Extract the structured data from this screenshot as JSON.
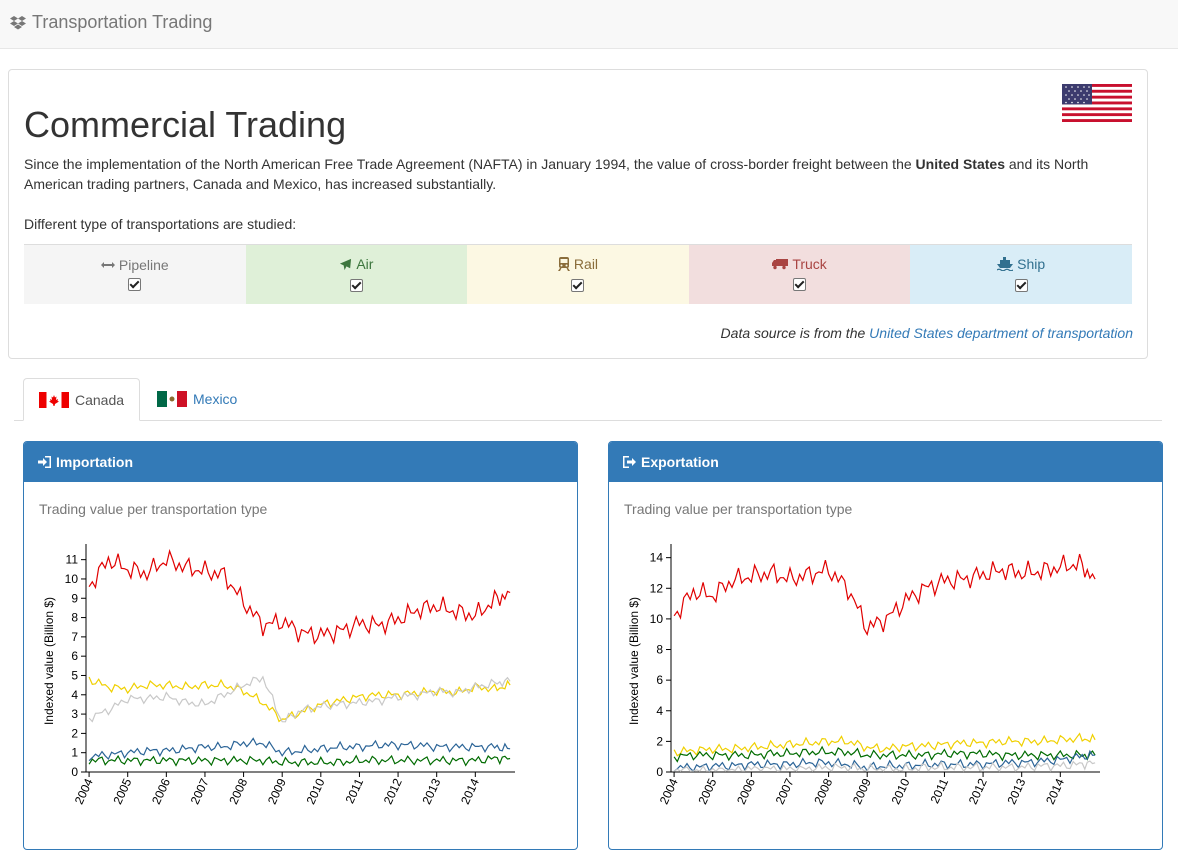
{
  "app": {
    "brand": "Transportation Trading"
  },
  "header": {
    "title": "Commercial Trading",
    "intro_before": "Since the implementation of the North American Free Trade Agreement (NAFTA) in January 1994, the value of cross-border freight between the ",
    "intro_bold": "United States",
    "intro_after": " and its North American trading partners, Canada and Mexico, has increased substantially.",
    "studied": "Different type of transportations are studied:",
    "source_prefix": "Data source is from the ",
    "source_link": "United States department of transportation"
  },
  "transports": [
    {
      "label": "Pipeline",
      "icon": "arrows-h-icon",
      "checked": true
    },
    {
      "label": "Air",
      "icon": "plane-icon",
      "checked": true
    },
    {
      "label": "Rail",
      "icon": "train-icon",
      "checked": true
    },
    {
      "label": "Truck",
      "icon": "truck-icon",
      "checked": true
    },
    {
      "label": "Ship",
      "icon": "ship-icon",
      "checked": true
    }
  ],
  "tabs": [
    {
      "label": "Canada",
      "active": true
    },
    {
      "label": "Mexico",
      "active": false
    }
  ],
  "panels": {
    "import": {
      "title": "Importation",
      "subtitle": "Trading value per transportation type"
    },
    "export": {
      "title": "Exportation",
      "subtitle": "Trading value per transportation type"
    }
  },
  "colors": {
    "truck": "#e00000",
    "rail": "#f0d000",
    "pipeline": "#c8c8c8",
    "ship": "#2b6497",
    "air": "#006b00",
    "primary": "#337ab7"
  },
  "chart_data": [
    {
      "type": "line",
      "title": "Importation",
      "ylabel": "Indexed value (Billion $)",
      "xlabel": "",
      "ylim": [
        0,
        11.5
      ],
      "yticks": [
        "0",
        "1",
        "2",
        "3",
        "4",
        "5",
        "6",
        "7",
        "8",
        "9",
        "10",
        "11"
      ],
      "xticks": [
        "2004",
        "2005",
        "2006",
        "2007",
        "2008",
        "2009",
        "2010",
        "2011",
        "2012",
        "2013",
        "2014"
      ],
      "x": [
        2004.0,
        2004.5,
        2005.0,
        2005.5,
        2006.0,
        2006.5,
        2007.0,
        2007.5,
        2008.0,
        2008.5,
        2009.0,
        2009.5,
        2010.0,
        2010.5,
        2011.0,
        2011.5,
        2012.0,
        2012.5,
        2013.0,
        2013.5,
        2014.0,
        2014.5,
        2014.9
      ],
      "series": [
        {
          "name": "Truck",
          "color": "#e00000",
          "values": [
            9.6,
            11.0,
            10.5,
            10.3,
            11.0,
            10.6,
            10.4,
            10.2,
            8.8,
            7.6,
            7.8,
            7.2,
            7.1,
            7.3,
            7.7,
            7.6,
            7.9,
            8.4,
            8.6,
            8.3,
            8.1,
            8.9,
            9.3
          ]
        },
        {
          "name": "Rail",
          "color": "#f0d000",
          "values": [
            4.8,
            4.4,
            4.3,
            4.5,
            4.5,
            4.4,
            4.5,
            4.5,
            4.2,
            3.6,
            2.7,
            3.1,
            3.5,
            3.7,
            3.9,
            4.0,
            4.0,
            4.1,
            4.2,
            4.1,
            4.4,
            4.3,
            4.5
          ]
        },
        {
          "name": "Pipeline",
          "color": "#c8c8c8",
          "values": [
            2.8,
            3.2,
            3.8,
            3.8,
            3.9,
            3.6,
            3.5,
            4.0,
            4.5,
            4.9,
            2.6,
            3.2,
            3.4,
            3.5,
            3.6,
            3.7,
            3.9,
            4.0,
            4.2,
            4.1,
            4.4,
            4.6,
            4.7
          ]
        },
        {
          "name": "Ship",
          "color": "#2b6497",
          "values": [
            0.8,
            0.9,
            1.0,
            1.1,
            1.1,
            1.2,
            1.3,
            1.3,
            1.5,
            1.5,
            1.0,
            1.1,
            1.2,
            1.3,
            1.3,
            1.4,
            1.4,
            1.4,
            1.3,
            1.3,
            1.3,
            1.3,
            1.2
          ]
        },
        {
          "name": "Air",
          "color": "#006b00",
          "values": [
            0.6,
            0.6,
            0.6,
            0.6,
            0.6,
            0.6,
            0.6,
            0.6,
            0.6,
            0.6,
            0.5,
            0.5,
            0.5,
            0.5,
            0.6,
            0.6,
            0.6,
            0.6,
            0.6,
            0.6,
            0.6,
            0.7,
            0.7
          ]
        }
      ]
    },
    {
      "type": "line",
      "title": "Exportation",
      "ylabel": "Indexed value (Billion $)",
      "xlabel": "",
      "ylim": [
        0,
        14.5
      ],
      "yticks": [
        "0",
        "2",
        "4",
        "6",
        "8",
        "10",
        "12",
        "14"
      ],
      "xticks": [
        "2004",
        "2005",
        "2006",
        "2007",
        "2008",
        "2009",
        "2010",
        "2011",
        "2012",
        "2013",
        "2014"
      ],
      "x": [
        2004.0,
        2004.5,
        2005.0,
        2005.5,
        2006.0,
        2006.5,
        2007.0,
        2007.5,
        2008.0,
        2008.5,
        2009.0,
        2009.5,
        2010.0,
        2010.5,
        2011.0,
        2011.5,
        2012.0,
        2012.5,
        2013.0,
        2013.5,
        2014.0,
        2014.5,
        2014.9
      ],
      "series": [
        {
          "name": "Truck",
          "color": "#e00000",
          "values": [
            10.2,
            11.8,
            11.5,
            12.5,
            12.8,
            13.0,
            12.6,
            12.9,
            13.2,
            12.0,
            9.4,
            10.0,
            11.2,
            12.0,
            12.5,
            12.6,
            12.9,
            13.2,
            13.0,
            13.1,
            13.4,
            13.6,
            12.6
          ]
        },
        {
          "name": "Rail",
          "color": "#f0d000",
          "values": [
            1.3,
            1.4,
            1.5,
            1.5,
            1.6,
            1.7,
            1.8,
            1.9,
            2.0,
            2.0,
            1.6,
            1.5,
            1.7,
            1.7,
            1.8,
            1.9,
            1.9,
            2.0,
            2.0,
            2.0,
            2.1,
            2.2,
            2.1
          ]
        },
        {
          "name": "Air",
          "color": "#006b00",
          "values": [
            1.0,
            1.1,
            1.1,
            1.1,
            1.1,
            1.2,
            1.2,
            1.3,
            1.3,
            1.3,
            1.1,
            1.1,
            1.1,
            1.1,
            1.2,
            1.2,
            1.2,
            1.1,
            1.1,
            1.1,
            1.1,
            1.1,
            1.1
          ]
        },
        {
          "name": "Ship",
          "color": "#2b6497",
          "values": [
            0.3,
            0.3,
            0.4,
            0.4,
            0.5,
            0.5,
            0.5,
            0.6,
            0.6,
            0.5,
            0.3,
            0.4,
            0.4,
            0.5,
            0.5,
            0.5,
            0.5,
            0.6,
            0.6,
            0.7,
            0.8,
            1.0,
            1.1
          ]
        },
        {
          "name": "Pipeline",
          "color": "#c8c8c8",
          "values": [
            0.1,
            0.1,
            0.1,
            0.1,
            0.2,
            0.2,
            0.2,
            0.2,
            0.3,
            0.3,
            0.2,
            0.2,
            0.2,
            0.3,
            0.3,
            0.3,
            0.3,
            0.3,
            0.3,
            0.4,
            0.4,
            0.5,
            0.6
          ]
        }
      ]
    }
  ]
}
